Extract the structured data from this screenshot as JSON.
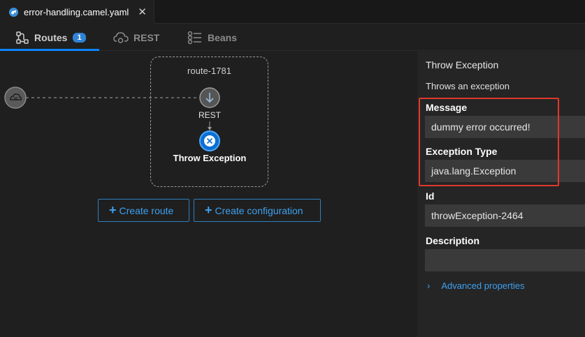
{
  "editor_tab": {
    "filename": "error-handling.camel.yaml",
    "close_label": "✕"
  },
  "view_tabs": [
    {
      "label": "Routes",
      "badge": "1"
    },
    {
      "label": "REST"
    },
    {
      "label": "Beans"
    }
  ],
  "canvas": {
    "route_id": "route-1781",
    "nodes": [
      {
        "label": "REST"
      },
      {
        "label": "Throw Exception"
      }
    ],
    "buttons": {
      "create_route": "Create route",
      "create_configuration": "Create configuration"
    }
  },
  "properties": {
    "title": "Throw Exception",
    "description": "Throws an exception",
    "fields": [
      {
        "label": "Message",
        "value": "dummy error occurred!"
      },
      {
        "label": "Exception Type",
        "value": "java.lang.Exception"
      },
      {
        "label": "Id",
        "value": "throwException-2464"
      },
      {
        "label": "Description",
        "value": ""
      }
    ],
    "advanced_label": "Advanced properties"
  },
  "colors": {
    "accent": "#0a84ff",
    "link": "#3ea0ee",
    "highlight": "#e0392b"
  }
}
